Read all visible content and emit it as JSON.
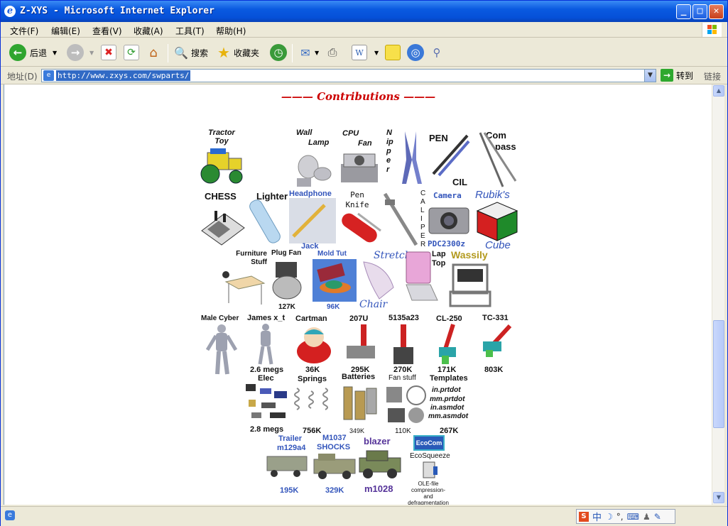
{
  "window": {
    "title": "Z-XYS - Microsoft Internet Explorer"
  },
  "menu": [
    "文件(F)",
    "编辑(E)",
    "查看(V)",
    "收藏(A)",
    "工具(T)",
    "帮助(H)"
  ],
  "toolbar": {
    "back": "后退",
    "search": "搜索",
    "favorites": "收藏夹"
  },
  "address": {
    "label": "地址(D)",
    "url": "http://www.zxys.com/swparts/",
    "go": "转到",
    "links": "链接"
  },
  "page": {
    "heading": "——— Contributions ———",
    "labels": {
      "tractor": "Tractor Toy",
      "wall": "Wall",
      "lamp": "Lamp",
      "cpu": "CPU",
      "fan": "Fan",
      "nipper": "Nipper",
      "pen": "PEN",
      "cil": "CIL",
      "com": "Com",
      "pass": "pass",
      "chess": "CHESS",
      "lighter": "Lighter",
      "headphone": "Headphone",
      "jack": "Jack",
      "pen_knife": "Pen Knife",
      "caliper": "CALIPER",
      "camera": "Camera",
      "pdc": "PDC2300z",
      "rubiks": "Rubik's",
      "cube": "Cube",
      "furniture": "Furniture Stuff",
      "plug_fan": "Plug Fan",
      "size_127k": "127K",
      "mold_tut": "Mold Tut",
      "size_96k": "96K",
      "stretch": "Stretch",
      "chair": "Chair",
      "laptop": "Lap Top",
      "wassily": "Wassily",
      "male_cyber": "Male Cyber",
      "james": "James x_t",
      "size_26megs": "2.6 megs",
      "cartman": "Cartman",
      "size_36k": "36K",
      "p207u": "207U",
      "size_295k": "295K",
      "p5135": "5135a23",
      "size_270k": "270K",
      "cl250": "CL-250",
      "size_171k": "171K",
      "tc331": "TC-331",
      "size_803k": "803K",
      "elec": "Elec",
      "size_28megs": "2.8 megs",
      "springs": "Springs",
      "size_756k": "756K",
      "batteries": "Batteries",
      "size_349k": "349K",
      "fan_stuff": "Fan stuff",
      "size_110k": "110K",
      "templates": "Templates",
      "tpl1": "in.prtdot",
      "tpl2": "mm.prtdot",
      "tpl3": "in.asmdot",
      "tpl4": "mm.asmdot",
      "size_267k": "267K",
      "trailer": "Trailer",
      "m129": "m129a4",
      "size_195k": "195K",
      "m1037": "M1037",
      "shocks": "SHOCKS",
      "size_329k": "329K",
      "blazer": "blazer",
      "m1028": "m1028",
      "ecocom": "EcoCom",
      "ecosqueeze": "EcoSqueeze",
      "ole": "OLE-file compression- and defragmentation"
    }
  },
  "colors": {
    "title_blue": "#0A5AE0",
    "heading_red": "#CC0000",
    "link_blue": "#3355BB"
  }
}
